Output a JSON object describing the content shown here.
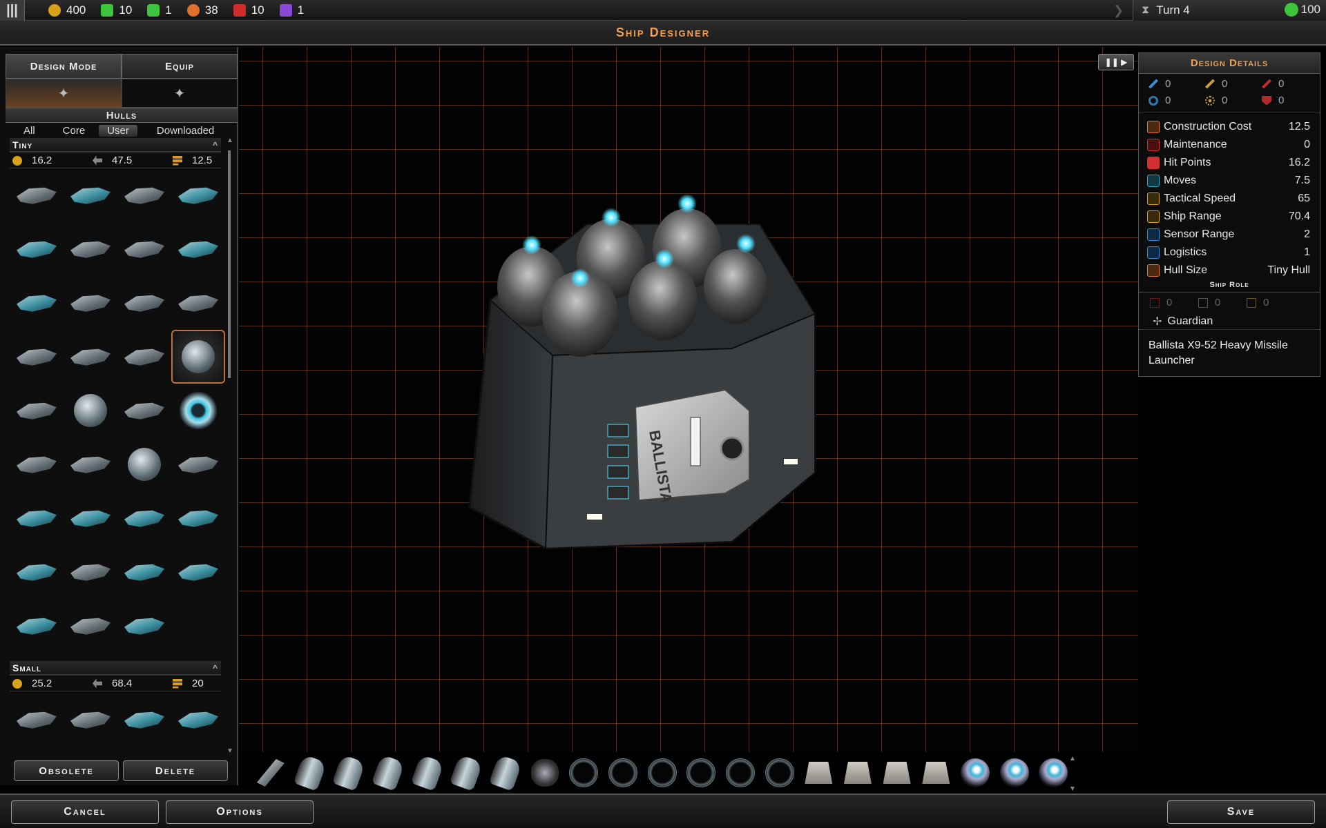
{
  "topbar": {
    "resources": [
      {
        "name": "credits",
        "value": "400",
        "color": "#d8a21a",
        "icon": "credits-icon"
      },
      {
        "name": "population",
        "value": "10",
        "color": "#3cc43c",
        "icon": "population-icon"
      },
      {
        "name": "food",
        "value": "1",
        "color": "#3cc43c",
        "icon": "food-icon"
      },
      {
        "name": "manufacturing",
        "value": "38",
        "color": "#e0702a",
        "icon": "manufacturing-icon"
      },
      {
        "name": "military",
        "value": "10",
        "color": "#d02a2a",
        "icon": "military-icon"
      },
      {
        "name": "influence",
        "value": "1",
        "color": "#8a4ad8",
        "icon": "influence-icon"
      }
    ],
    "turn": "Turn 4",
    "approval": "100"
  },
  "title": "Ship Designer",
  "left_panel": {
    "tabs": [
      "Design Mode",
      "Equip"
    ],
    "hulls_label": "Hulls",
    "filters": [
      "All",
      "Core",
      "User",
      "Downloaded"
    ],
    "selected_filter": "User",
    "sections": [
      {
        "name": "Tiny",
        "cost": "16.2",
        "moves": "47.5",
        "hp": "12.5"
      },
      {
        "name": "Small",
        "cost": "25.2",
        "moves": "68.4",
        "hp": "20"
      }
    ],
    "obsolete_label": "Obsolete",
    "delete_label": "Delete"
  },
  "details": {
    "title": "Design Details",
    "weapons": [
      {
        "icon": "beam-icon",
        "value": "0",
        "color": "#3a8fd8"
      },
      {
        "icon": "missile-icon",
        "value": "0",
        "color": "#c8a040"
      },
      {
        "icon": "kinetic-icon",
        "value": "0",
        "color": "#c02a2a"
      },
      {
        "icon": "shield-ring-icon",
        "value": "0",
        "color": "#2a7ab0"
      },
      {
        "icon": "point-defense-icon",
        "value": "0",
        "color": "#c8a040"
      },
      {
        "icon": "armor-icon",
        "value": "0",
        "color": "#b02a2a"
      }
    ],
    "stats": [
      {
        "label": "Construction Cost",
        "value": "12.5",
        "color": "#e07a30",
        "icon": "construction-icon"
      },
      {
        "label": "Maintenance",
        "value": "0",
        "color": "#d03030",
        "icon": "maintenance-icon"
      },
      {
        "label": "Hit Points",
        "value": "16.2",
        "color": "#d03030",
        "icon": "hit-points-icon"
      },
      {
        "label": "Moves",
        "value": "7.5",
        "color": "#2aa8c0",
        "icon": "moves-icon"
      },
      {
        "label": "Tactical Speed",
        "value": "65",
        "color": "#d8a21a",
        "icon": "tactical-speed-icon"
      },
      {
        "label": "Ship Range",
        "value": "70.4",
        "color": "#d8a21a",
        "icon": "ship-range-icon"
      },
      {
        "label": "Sensor Range",
        "value": "2",
        "color": "#2a8fd8",
        "icon": "sensor-icon"
      },
      {
        "label": "Logistics",
        "value": "1",
        "color": "#2a8fd8",
        "icon": "logistics-icon"
      },
      {
        "label": "Hull Size",
        "value": "Tiny Hull",
        "color": "#e07a30",
        "icon": "hull-size-icon"
      }
    ],
    "ship_role_label": "Ship Role",
    "role_stats": [
      "0",
      "0",
      "0"
    ],
    "role": "Guardian",
    "module_name": "Ballista X9-52 Heavy Missile Launcher"
  },
  "bottom": {
    "cancel_label": "Cancel",
    "options_label": "Options",
    "save_label": "Save"
  }
}
